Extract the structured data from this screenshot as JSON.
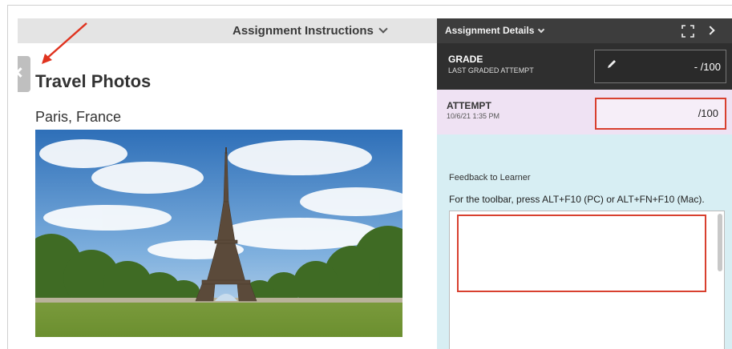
{
  "left_panel": {
    "header_title": "Assignment Instructions",
    "title": "Travel Photos",
    "subtitle": "Paris, France"
  },
  "right_panel": {
    "header_title": "Assignment Details",
    "grade": {
      "title": "GRADE",
      "subtitle": "LAST GRADED ATTEMPT",
      "value": "- /100"
    },
    "attempt": {
      "title": "ATTEMPT",
      "date": "10/6/21 1:35 PM",
      "value": "/100"
    },
    "feedback": {
      "label": "Feedback to Learner",
      "toolbar_hint": "For the toolbar, press ALT+F10 (PC) or ALT+FN+F10 (Mac)."
    }
  },
  "colors": {
    "highlight_red": "#d8402f",
    "attempt_bg": "#efe2f3",
    "feedback_bg": "#d7eef3",
    "dark_header": "#3d3d3d"
  },
  "icons": [
    "chevron-down-icon",
    "collapse-arrow-icon",
    "expand-icon",
    "chevron-right-icon",
    "pencil-icon"
  ]
}
